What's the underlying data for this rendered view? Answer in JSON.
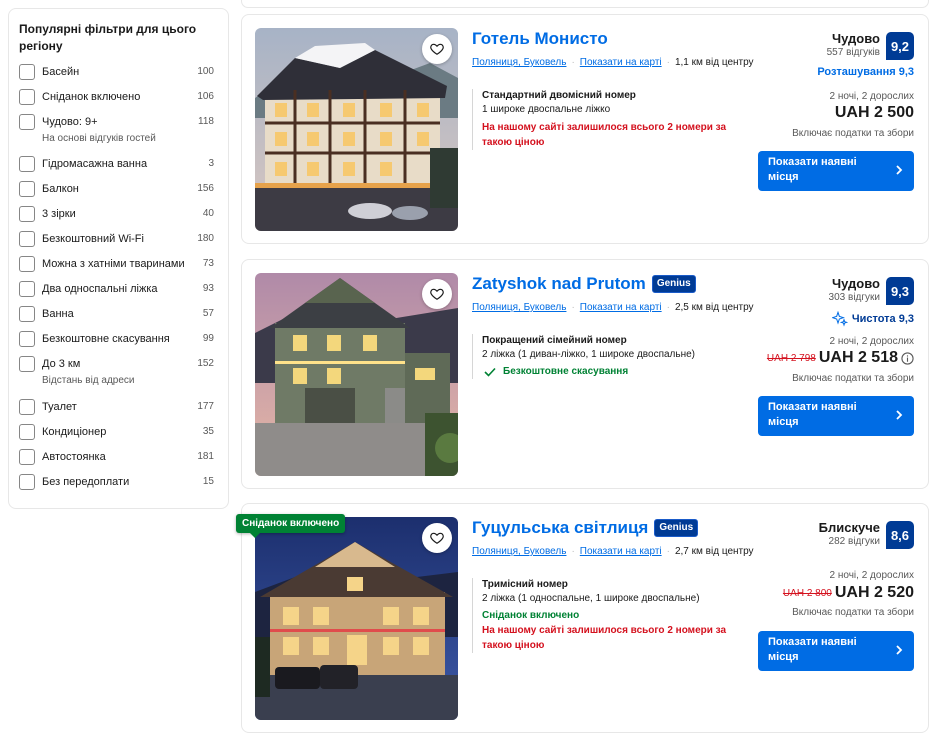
{
  "sidebar": {
    "title": "Популярні фільтри для цього регіону",
    "filters": [
      {
        "label": "Басейн",
        "count": "100"
      },
      {
        "label": "Сніданок включено",
        "count": "106"
      },
      {
        "label": "Чудово: 9+",
        "count": "118",
        "sub": "На основі відгуків гостей"
      },
      {
        "label": "Гідромасажна ванна",
        "count": "3"
      },
      {
        "label": "Балкон",
        "count": "156"
      },
      {
        "label": "3 зірки",
        "count": "40"
      },
      {
        "label": "Безкоштовний Wi-Fi",
        "count": "180"
      },
      {
        "label": "Можна з хатніми тваринами",
        "count": "73"
      },
      {
        "label": "Два односпальні ліжка",
        "count": "93"
      },
      {
        "label": "Ванна",
        "count": "57"
      },
      {
        "label": "Безкоштовне скасування",
        "count": "99"
      },
      {
        "label": "До 3 км",
        "count": "152",
        "sub": "Відстань від адреси"
      },
      {
        "label": "Туалет",
        "count": "177"
      },
      {
        "label": "Кондиціонер",
        "count": "35"
      },
      {
        "label": "Автостоянка",
        "count": "181"
      },
      {
        "label": "Без передоплати",
        "count": "15"
      }
    ]
  },
  "hotels": [
    {
      "name": "Готель Монисто",
      "city": "Поляниця, Буковель",
      "map_link": "Показати на карті",
      "distance": "1,1 км від центру",
      "room_title": "Стандартний двомісний номер",
      "room_bed": "1 широке двоспальне ліжко",
      "warning": "На нашому сайті залишилося всього 2 номери за такою ціною",
      "rating_word": "Чудово",
      "reviews": "557 відгуків",
      "score": "9,2",
      "subscore": "Розташування 9,3",
      "nights": "2 ночі, 2 дорослих",
      "price": "UAH 2 500",
      "taxes": "Включає податки та збори",
      "cta": "Показати наявні місця"
    },
    {
      "name": "Zatyshok nad Prutom",
      "badge": "Genius",
      "city": "Поляниця, Буковель",
      "map_link": "Показати на карті",
      "distance": "2,5 км від центру",
      "room_title": "Покращений сімейний номер",
      "room_bed": "2 ліжка (1 диван-ліжко, 1 широке двоспальне)",
      "free_cancel": "Безкоштовне скасування",
      "rating_word": "Чудово",
      "reviews": "303 відгуки",
      "score": "9,3",
      "subscore": "Чистота 9,3",
      "nights": "2 ночі, 2 дорослих",
      "old_price": "UAH 2 798",
      "price": "UAH 2 518",
      "taxes": "Включає податки та збори",
      "cta": "Показати наявні місця"
    },
    {
      "name": "Гуцульська світлиця",
      "badge": "Genius",
      "ribbon": "Сніданок включено",
      "city": "Поляниця, Буковель",
      "map_link": "Показати на карті",
      "distance": "2,7 км від центру",
      "room_title": "Тримісний номер",
      "room_bed": "2 ліжка (1 односпальне, 1 широке двоспальне)",
      "breakfast": "Сніданок включено",
      "warning": "На нашому сайті залишилося всього 2 номери за такою ціною",
      "rating_word": "Блискуче",
      "reviews": "282 відгуки",
      "score": "8,6",
      "nights": "2 ночі, 2 дорослих",
      "old_price": "UAH 2 800",
      "price": "UAH 2 520",
      "taxes": "Включає податки та збори",
      "cta": "Показати наявні місця"
    }
  ]
}
